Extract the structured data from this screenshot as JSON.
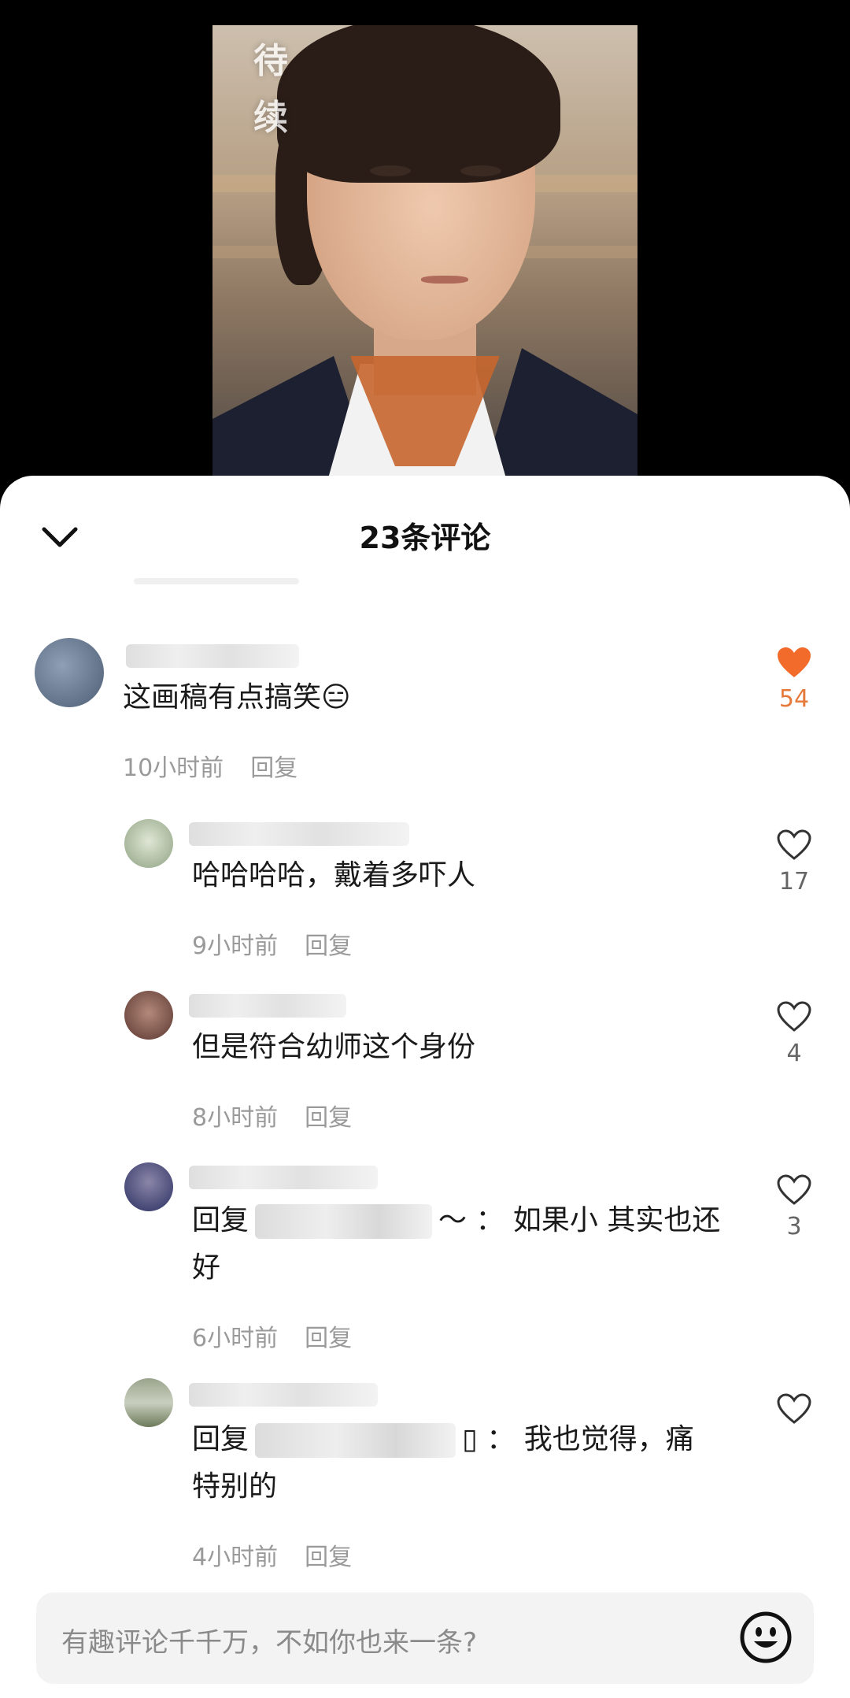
{
  "video": {
    "watermark": "待续"
  },
  "sheet": {
    "title": "23条评论"
  },
  "comments": [
    {
      "text": "这画稿有点搞笑😑",
      "time": "10小时前",
      "reply": "回复",
      "likes": "54",
      "liked": true
    },
    {
      "text": "哈哈哈哈，戴着多吓人",
      "time": "9小时前",
      "reply": "回复",
      "likes": "17",
      "liked": false
    },
    {
      "text": "但是符合幼师这个身份",
      "time": "8小时前",
      "reply": "回复",
      "likes": "4",
      "liked": false
    },
    {
      "prefix": "回复",
      "suffix": "～ ： 如果小 其实也还",
      "line2": "好",
      "time": "6小时前",
      "reply": "回复",
      "likes": "3",
      "liked": false
    },
    {
      "prefix": "回复",
      "suffix": "▯ ： 我也觉得，痛",
      "line2": "特别的",
      "time": "4小时前",
      "reply": "回复",
      "likes": "",
      "liked": false
    }
  ],
  "input": {
    "placeholder": "有趣评论千千万，不如你也来一条?"
  },
  "colors": {
    "like_active": "#f26b2b",
    "like_count_active": "#e57a3b"
  },
  "icons": {
    "collapse": "chevron-down-icon",
    "like": "heart-icon",
    "emoji": "smiley-icon"
  }
}
